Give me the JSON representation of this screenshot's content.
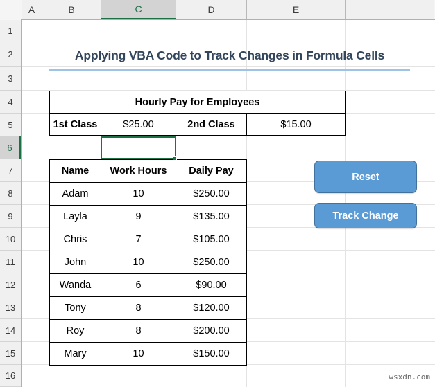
{
  "spreadsheet": {
    "columns": [
      "A",
      "B",
      "C",
      "D",
      "E"
    ],
    "selected_column": "C",
    "rows": [
      "1",
      "2",
      "3",
      "4",
      "5",
      "6",
      "7",
      "8",
      "9",
      "10",
      "11",
      "12",
      "13",
      "14",
      "15",
      "16"
    ],
    "selected_row": "6",
    "active_cell": "C6",
    "select_all_icon": "select-all-triangle-icon"
  },
  "title": {
    "text": "Applying VBA Code to Track Changes in Formula Cells",
    "underline_color": "#9DC3E6",
    "text_color": "#33465C"
  },
  "pay_table": {
    "header": "Hourly Pay for Employees",
    "header_bg": "#D9D9D9",
    "classes": [
      {
        "label": "1st Class",
        "value": "$25.00",
        "label_bg": "#FFD966"
      },
      {
        "label": "2nd Class",
        "value": "$15.00",
        "label_bg": "#B4C7E7"
      }
    ]
  },
  "employee_table": {
    "headers": [
      "Name",
      "Work Hours",
      "Daily Pay"
    ],
    "header_colors": [
      "#B4C7E7",
      "#F4B183",
      "#A9D18E"
    ],
    "rows": [
      {
        "name": "Adam",
        "hours": "10",
        "pay": "$250.00"
      },
      {
        "name": "Layla",
        "hours": "9",
        "pay": "$135.00"
      },
      {
        "name": "Chris",
        "hours": "7",
        "pay": "$105.00"
      },
      {
        "name": "John",
        "hours": "10",
        "pay": "$250.00"
      },
      {
        "name": "Wanda",
        "hours": "6",
        "pay": "$90.00"
      },
      {
        "name": "Tony",
        "hours": "8",
        "pay": "$120.00"
      },
      {
        "name": "Roy",
        "hours": "8",
        "pay": "$200.00"
      },
      {
        "name": "Mary",
        "hours": "10",
        "pay": "$150.00"
      }
    ]
  },
  "buttons": {
    "reset": "Reset",
    "track_change": "Track Change",
    "color": "#5B9BD5"
  },
  "watermark": "wsxdn.com"
}
